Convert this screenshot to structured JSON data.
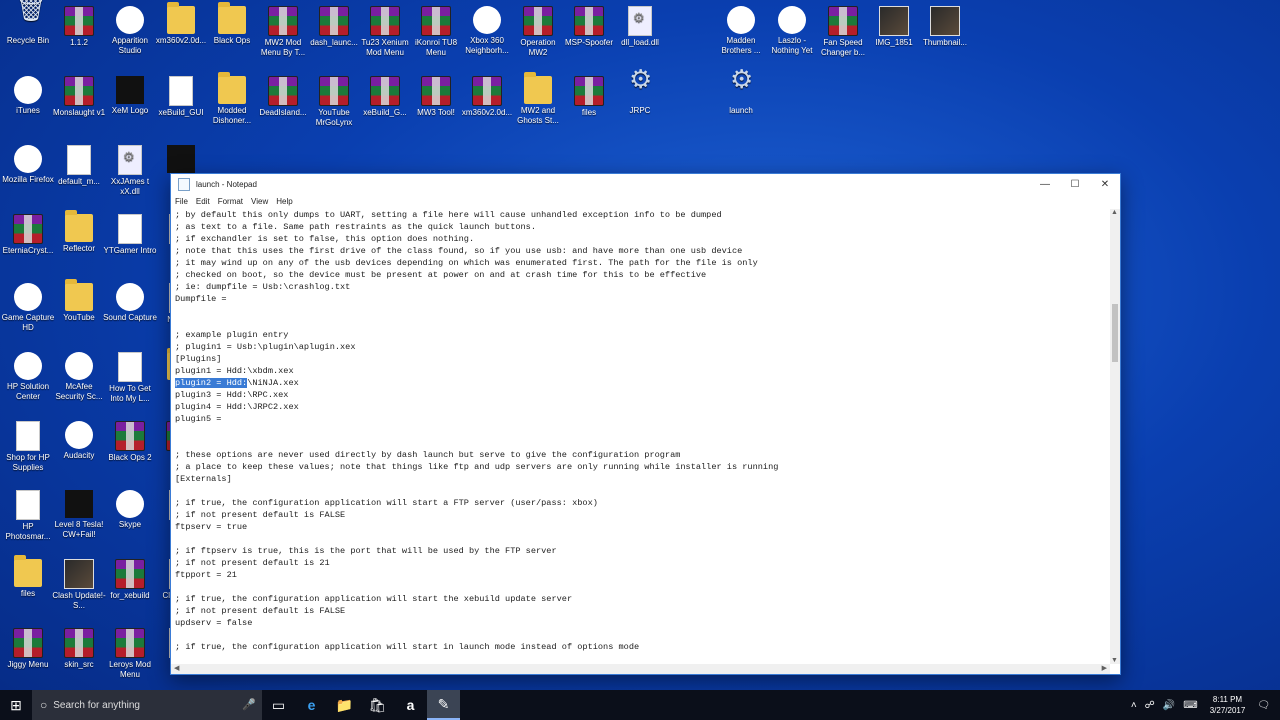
{
  "desktop_icons": [
    {
      "label": "Recycle Bin",
      "type": "recycle"
    },
    {
      "label": "1.1.2",
      "type": "rar"
    },
    {
      "label": "Apparition Studio",
      "type": "round"
    },
    {
      "label": "xm360v2.0d...",
      "type": "folder"
    },
    {
      "label": "Black Ops",
      "type": "folder"
    },
    {
      "label": "MW2 Mod Menu By T...",
      "type": "rar"
    },
    {
      "label": "dash_launc...",
      "type": "rar"
    },
    {
      "label": "Tu23 Xenium Mod Menu",
      "type": "rar"
    },
    {
      "label": "iKonroi TU8 Menu",
      "type": "rar"
    },
    {
      "label": "Xbox 360 Neighborh...",
      "type": "round"
    },
    {
      "label": "Operation MW2",
      "type": "rar"
    },
    {
      "label": "MSP-Spoofer",
      "type": "rar"
    },
    {
      "label": "dll_load.dll",
      "type": "dll"
    },
    {
      "label": "Madden Brothers ...",
      "type": "round"
    },
    {
      "label": "Laszlo - Nothing Yet",
      "type": "round"
    },
    {
      "label": "Fan Speed Changer b...",
      "type": "rar"
    },
    {
      "label": "IMG_1851",
      "type": "photo"
    },
    {
      "label": "Thumbnail...",
      "type": "photo"
    },
    {
      "label": "iTunes",
      "type": "round"
    },
    {
      "label": "Monslaught v1",
      "type": "rar"
    },
    {
      "label": "XeM Logo",
      "type": "dark"
    },
    {
      "label": "xeBuild_GUI",
      "type": "file"
    },
    {
      "label": "Modded Dishoner...",
      "type": "folder"
    },
    {
      "label": "DeadIsland...",
      "type": "rar"
    },
    {
      "label": "YouTube MrGoLynx",
      "type": "rar"
    },
    {
      "label": "xeBuild_G...",
      "type": "rar"
    },
    {
      "label": "MW3 Tool!",
      "type": "rar"
    },
    {
      "label": "xm360v2.0d...",
      "type": "rar"
    },
    {
      "label": "MW2 and Ghosts St...",
      "type": "folder"
    },
    {
      "label": "files",
      "type": "rar"
    },
    {
      "label": "JRPC",
      "type": "gear"
    },
    {
      "label": "launch",
      "type": "gear"
    },
    {
      "label": "Mozilla Firefox",
      "type": "round"
    },
    {
      "label": "default_m...",
      "type": "file"
    },
    {
      "label": "XxJAmes t xX.dll",
      "type": "dll"
    },
    {
      "label": "Fro",
      "type": "dark"
    },
    {
      "label": "EterniaCryst...",
      "type": "rar"
    },
    {
      "label": "Reflector",
      "type": "folder"
    },
    {
      "label": "YTGamer Intro",
      "type": "file"
    },
    {
      "label": "Jo Su",
      "type": "file"
    },
    {
      "label": "Game Capture HD",
      "type": "round"
    },
    {
      "label": "YouTube",
      "type": "folder"
    },
    {
      "label": "Sound Capture",
      "type": "round"
    },
    {
      "label": "N Flash",
      "type": "file"
    },
    {
      "label": "HP Solution Center",
      "type": "round"
    },
    {
      "label": "McAfee Security Sc...",
      "type": "round"
    },
    {
      "label": "How To Get Into My L...",
      "type": "file"
    },
    {
      "label": "Cybe",
      "type": "folder"
    },
    {
      "label": "Shop for HP Supplies",
      "type": "file"
    },
    {
      "label": "Audacity",
      "type": "round"
    },
    {
      "label": "Black Ops 2",
      "type": "rar"
    },
    {
      "label": "_RG",
      "type": "rar"
    },
    {
      "label": "HP Photosmar...",
      "type": "file"
    },
    {
      "label": "Level 8 Tesla! CW+Fail!",
      "type": "dark"
    },
    {
      "label": "Skype",
      "type": "round"
    },
    {
      "label": "o",
      "type": "file"
    },
    {
      "label": "files",
      "type": "folder"
    },
    {
      "label": "Clash Update!- S...",
      "type": "photo"
    },
    {
      "label": "for_xebuild",
      "type": "rar"
    },
    {
      "label": "Clas Snea",
      "type": "file"
    },
    {
      "label": "Jiggy Menu",
      "type": "rar"
    },
    {
      "label": "skin_src",
      "type": "rar"
    },
    {
      "label": "Leroys Mod Menu",
      "type": "rar"
    },
    {
      "label": "Disl",
      "type": "file"
    }
  ],
  "notepad": {
    "title": "launch - Notepad",
    "menu": [
      "File",
      "Edit",
      "Format",
      "View",
      "Help"
    ],
    "minimize": "—",
    "maximize": "☐",
    "close": "✕",
    "highlight_text": "plugin2 = Hdd:",
    "lines": [
      "; by default this only dumps to UART, setting a file here will cause unhandled exception info to be dumped",
      "; as text to a file. Same path restraints as the quick launch buttons.",
      "; if exchandler is set to false, this option does nothing.",
      "; note that this uses the first drive of the class found, so if you use usb: and have more than one usb device",
      "; it may wind up on any of the usb devices depending on which was enumerated first. The path for the file is only",
      "; checked on boot, so the device must be present at power on and at crash time for this to be effective",
      "; ie: dumpfile = Usb:\\crashlog.txt",
      "Dumpfile =",
      "",
      "",
      "; example plugin entry",
      "; plugin1 = Usb:\\plugin\\aplugin.xex",
      "[Plugins]",
      "plugin1 = Hdd:\\xbdm.xex",
      "\\NiNJA.xex",
      "plugin3 = Hdd:\\RPC.xex",
      "plugin4 = Hdd:\\JRPC2.xex",
      "plugin5 =",
      "",
      "",
      "; these options are never used directly by dash launch but serve to give the configuration program",
      "; a place to keep these values; note that things like ftp and udp servers are only running while installer is running",
      "[Externals]",
      "",
      "; if true, the configuration application will start a FTP server (user/pass: xbox)",
      "; if not present default is FALSE",
      "ftpserv = true",
      "",
      "; if ftpserv is true, this is the port that will be used by the FTP server",
      "; if not present default is 21",
      "ftpport = 21",
      "",
      "; if true, the configuration application will start the xebuild update server",
      "; if not present default is FALSE",
      "updserv = false",
      "",
      "; if true, the configuration application will start in launch mode instead of options mode"
    ]
  },
  "taskbar": {
    "start_icon": "⊞",
    "search_placeholder": "Search for anything",
    "search_icon": "○",
    "mic_icon": "🎤",
    "items": [
      {
        "name": "task-view-icon",
        "glyph": "▭"
      },
      {
        "name": "edge-icon",
        "glyph": "e"
      },
      {
        "name": "file-explorer-icon",
        "glyph": "📁"
      },
      {
        "name": "store-icon",
        "glyph": "🛍"
      },
      {
        "name": "amazon-icon",
        "glyph": "a"
      },
      {
        "name": "notepad-icon",
        "glyph": "✎"
      }
    ],
    "tray": [
      "˄",
      "☍",
      "🔊",
      "⌨"
    ],
    "time": "8:11 PM",
    "date": "3/27/2017",
    "notification_icon": "🗨"
  }
}
